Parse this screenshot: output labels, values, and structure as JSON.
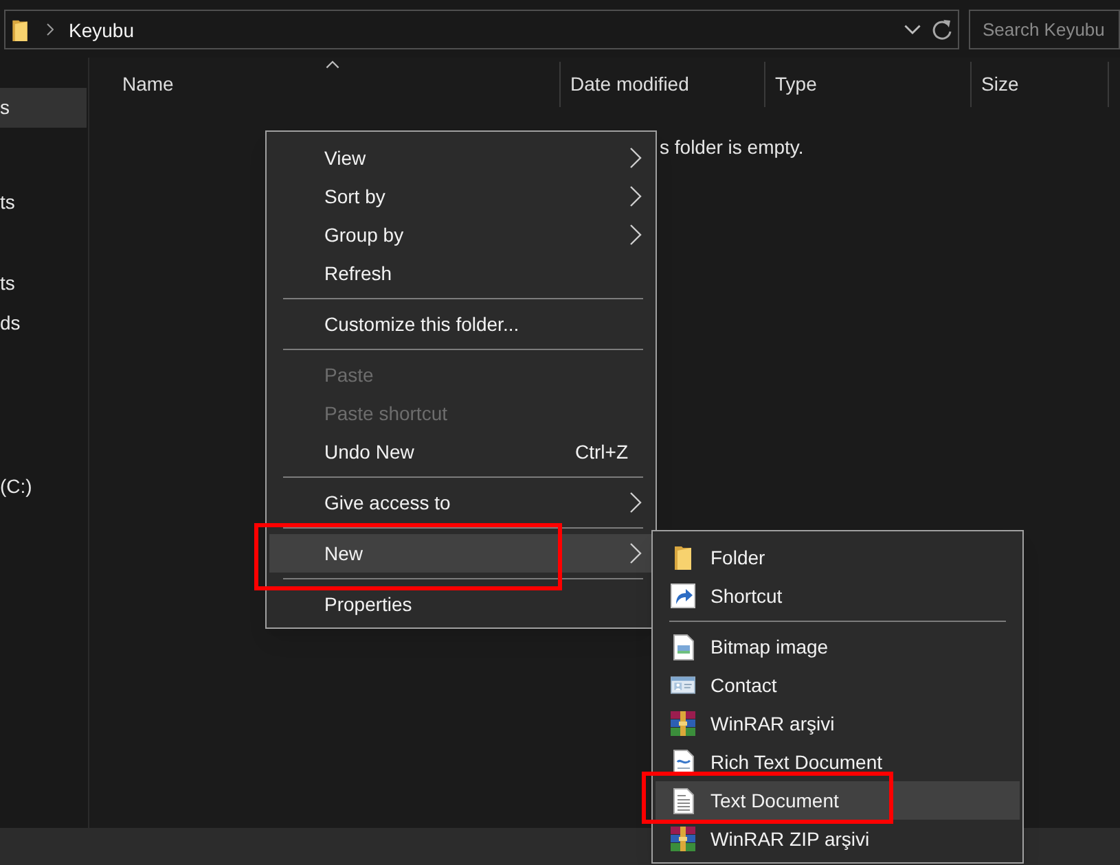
{
  "address_bar": {
    "path": [
      "Keyubu"
    ]
  },
  "search": {
    "placeholder": "Search Keyubu"
  },
  "sidebar": {
    "items": [
      {
        "label": "s",
        "selected": true
      },
      {
        "label": "ts",
        "selected": false
      },
      {
        "label": "ts",
        "selected": false
      },
      {
        "label": "ds",
        "selected": false
      },
      {
        "label": "(C:)",
        "selected": false
      }
    ]
  },
  "columns": [
    {
      "label": "Name",
      "sorted": true
    },
    {
      "label": "Date modified",
      "sorted": false
    },
    {
      "label": "Type",
      "sorted": false
    },
    {
      "label": "Size",
      "sorted": false
    }
  ],
  "empty_message": "s folder is empty.",
  "context_menu": {
    "items": [
      {
        "kind": "item",
        "label": "View",
        "submenu": true,
        "disabled": false,
        "selected": false,
        "annotated": false
      },
      {
        "kind": "item",
        "label": "Sort by",
        "submenu": true,
        "disabled": false,
        "selected": false,
        "annotated": false
      },
      {
        "kind": "item",
        "label": "Group by",
        "submenu": true,
        "disabled": false,
        "selected": false,
        "annotated": false
      },
      {
        "kind": "item",
        "label": "Refresh",
        "submenu": false,
        "disabled": false,
        "selected": false,
        "annotated": false
      },
      {
        "kind": "separator"
      },
      {
        "kind": "item",
        "label": "Customize this folder...",
        "submenu": false,
        "disabled": false,
        "selected": false,
        "annotated": false
      },
      {
        "kind": "separator"
      },
      {
        "kind": "item",
        "label": "Paste",
        "submenu": false,
        "disabled": true,
        "selected": false,
        "annotated": false
      },
      {
        "kind": "item",
        "label": "Paste shortcut",
        "submenu": false,
        "disabled": true,
        "selected": false,
        "annotated": false
      },
      {
        "kind": "item",
        "label": "Undo New",
        "shortcut": "Ctrl+Z",
        "submenu": false,
        "disabled": false,
        "selected": false,
        "annotated": false
      },
      {
        "kind": "separator"
      },
      {
        "kind": "item",
        "label": "Give access to",
        "submenu": true,
        "disabled": false,
        "selected": false,
        "annotated": false
      },
      {
        "kind": "separator"
      },
      {
        "kind": "item",
        "label": "New",
        "submenu": true,
        "disabled": false,
        "selected": true,
        "annotated": true
      },
      {
        "kind": "separator"
      },
      {
        "kind": "item",
        "label": "Properties",
        "submenu": false,
        "disabled": false,
        "selected": false,
        "annotated": false
      }
    ]
  },
  "submenu": {
    "items": [
      {
        "kind": "folder",
        "label": "Folder",
        "selected": false,
        "annotated": false
      },
      {
        "kind": "shortcut",
        "label": "Shortcut",
        "selected": false,
        "annotated": false
      },
      {
        "kind": "separator"
      },
      {
        "kind": "bitmap",
        "label": "Bitmap image",
        "selected": false,
        "annotated": false
      },
      {
        "kind": "contact",
        "label": "Contact",
        "selected": false,
        "annotated": false
      },
      {
        "kind": "archive",
        "label": "WinRAR arşivi",
        "selected": false,
        "annotated": false
      },
      {
        "kind": "rich_text",
        "label": "Rich Text Document",
        "selected": false,
        "annotated": false
      },
      {
        "kind": "text",
        "label": "Text Document",
        "selected": true,
        "annotated": true
      },
      {
        "kind": "zip_archive",
        "label": "WinRAR ZIP arşivi",
        "selected": false,
        "annotated": false
      }
    ]
  }
}
